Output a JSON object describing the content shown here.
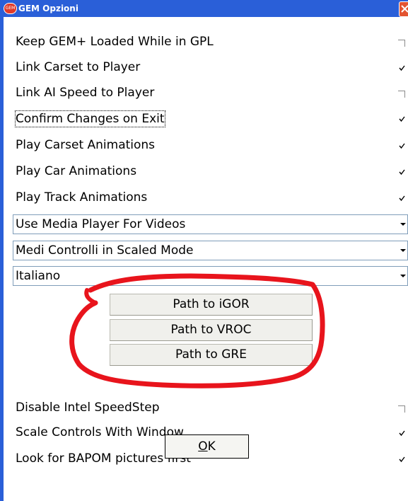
{
  "window": {
    "title": "GEM Opzioni",
    "app_icon_label": "GEM",
    "close_icon": "close-icon"
  },
  "options": [
    {
      "label": "Keep GEM+ Loaded While in GPL",
      "checked": false
    },
    {
      "label": "Link Carset to Player",
      "checked": true
    },
    {
      "label": "Link AI Speed to Player",
      "checked": false
    },
    {
      "label": "Confirm Changes on Exit",
      "checked": true,
      "focused": true
    },
    {
      "label": "Play Carset Animations",
      "checked": true
    },
    {
      "label": "Play Car Animations",
      "checked": true
    },
    {
      "label": "Play Track Animations",
      "checked": true
    }
  ],
  "selects": [
    {
      "value": "Use Media Player For Videos"
    },
    {
      "value": "Medi Controlli in Scaled Mode"
    },
    {
      "value": "Italiano"
    }
  ],
  "path_buttons": [
    {
      "label": "Path to iGOR"
    },
    {
      "label": "Path to VROC"
    },
    {
      "label": "Path to GRE"
    }
  ],
  "bottom_options": [
    {
      "label": "Disable Intel SpeedStep",
      "checked": false
    },
    {
      "label": "Scale Controls With Window",
      "checked": true
    },
    {
      "label": "Look for BAPOM pictures first",
      "checked": true
    }
  ],
  "ok_button": {
    "label_accel": "O",
    "label_rest": "K"
  },
  "colors": {
    "titlebar": "#2a5fd8",
    "close_button": "#e35431",
    "annotation_circle": "#e8141c"
  }
}
